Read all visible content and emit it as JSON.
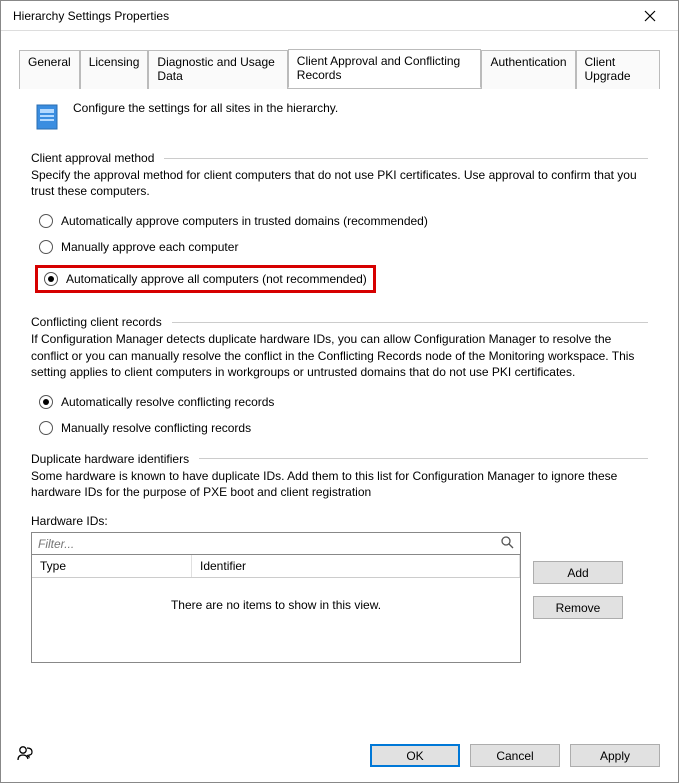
{
  "window": {
    "title": "Hierarchy Settings Properties"
  },
  "tabs": {
    "general": "General",
    "licensing": "Licensing",
    "diagnostic": "Diagnostic and Usage Data",
    "client_approval": "Client Approval and Conflicting Records",
    "authentication": "Authentication",
    "client_upgrade": "Client Upgrade"
  },
  "intro": "Configure the settings for all sites in the hierarchy.",
  "approval": {
    "title": "Client approval method",
    "desc": "Specify the approval method for client computers that do not use PKI certificates. Use approval to confirm that you trust these computers.",
    "opt1": "Automatically approve computers in trusted domains (recommended)",
    "opt2": "Manually approve each computer",
    "opt3": "Automatically approve all computers (not recommended)"
  },
  "conflict": {
    "title": "Conflicting client records",
    "desc": "If Configuration Manager detects duplicate hardware IDs, you can allow Configuration Manager to resolve the conflict or you can manually resolve the conflict in the Conflicting Records node of the Monitoring workspace. This setting applies to client computers in workgroups or untrusted domains that do not use PKI certificates.",
    "opt1": "Automatically resolve conflicting records",
    "opt2": "Manually resolve conflicting records"
  },
  "dup": {
    "title": "Duplicate hardware identifiers",
    "desc": "Some hardware is known to have duplicate IDs. Add them to this list for Configuration Manager to ignore these hardware IDs for the purpose of PXE boot and client registration",
    "hw_label": "Hardware IDs:",
    "filter_placeholder": "Filter...",
    "col_type": "Type",
    "col_id": "Identifier",
    "empty": "There are no items to show in this view."
  },
  "buttons": {
    "add": "Add",
    "remove": "Remove",
    "ok": "OK",
    "cancel": "Cancel",
    "apply": "Apply"
  }
}
